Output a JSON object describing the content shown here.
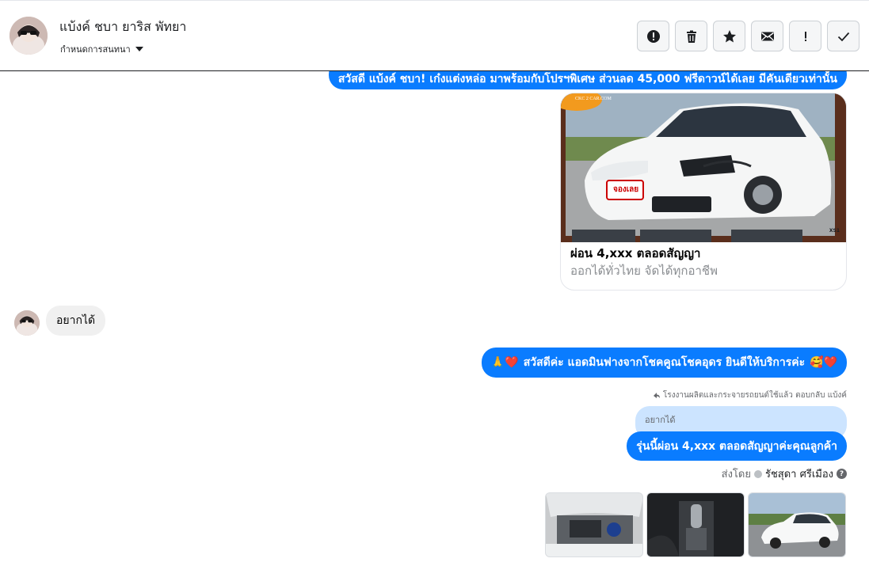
{
  "header": {
    "contact_name": "แบ้งค์ ชบา ยาริส พัทยา",
    "subtitle": "กำหนดการสนทนา",
    "actions": [
      {
        "name": "report-button",
        "icon": "alert-circle-icon"
      },
      {
        "name": "delete-button",
        "icon": "trash-icon"
      },
      {
        "name": "star-button",
        "icon": "star-icon"
      },
      {
        "name": "mark-unread-button",
        "icon": "envelope-icon"
      },
      {
        "name": "important-button",
        "icon": "exclamation-icon"
      },
      {
        "name": "done-button",
        "icon": "check-icon"
      }
    ]
  },
  "messages": {
    "greeting": "สวัสดี แบ้งค์ ชบา! เก๋งแต่งหล่อ มาพร้อมกับโปรฯพิเศษ ส่วนลด 45,000 ฟรีดาวน์ได้เลย มีคันเดียวเท่านั้น",
    "card": {
      "badge": "จองเลย",
      "logo": "CKC 2 CAR.COM",
      "tag": "XS1",
      "title": "ผ่อน 4,xxx ตลอดสัญญา",
      "subtitle": "ออกได้ทั่วไทย จัดได้ทุกอาชีพ"
    },
    "customer_msg": "อยากได้",
    "welcome_emoji_left": "🙏❤️",
    "welcome_text": "สวัสดีค่ะ แอดมินฟางจากโชคคูณโชคอุดร ยินดีให้บริการค่ะ",
    "welcome_emoji_right": "🥰❤️",
    "reply_meta": "โรงงานผลิตและกระจายรถยนต์ใช้แล้ว ตอบกลับ แบ้งค์",
    "quoted_text": "อยากได้",
    "reply_text": "รุ่นนี้ผ่อน 4,xxx ตลอดสัญญาค่ะคุณลูกค้า",
    "sent_by_label": "ส่งโดย",
    "sent_by_agent": "รัชสุดา ศรีเมือง",
    "help_glyph": "?"
  },
  "colors": {
    "outgoing_bubble": "#0a7cff",
    "incoming_bubble": "#f0f0f0",
    "quote_bubble": "#cce4ff"
  }
}
